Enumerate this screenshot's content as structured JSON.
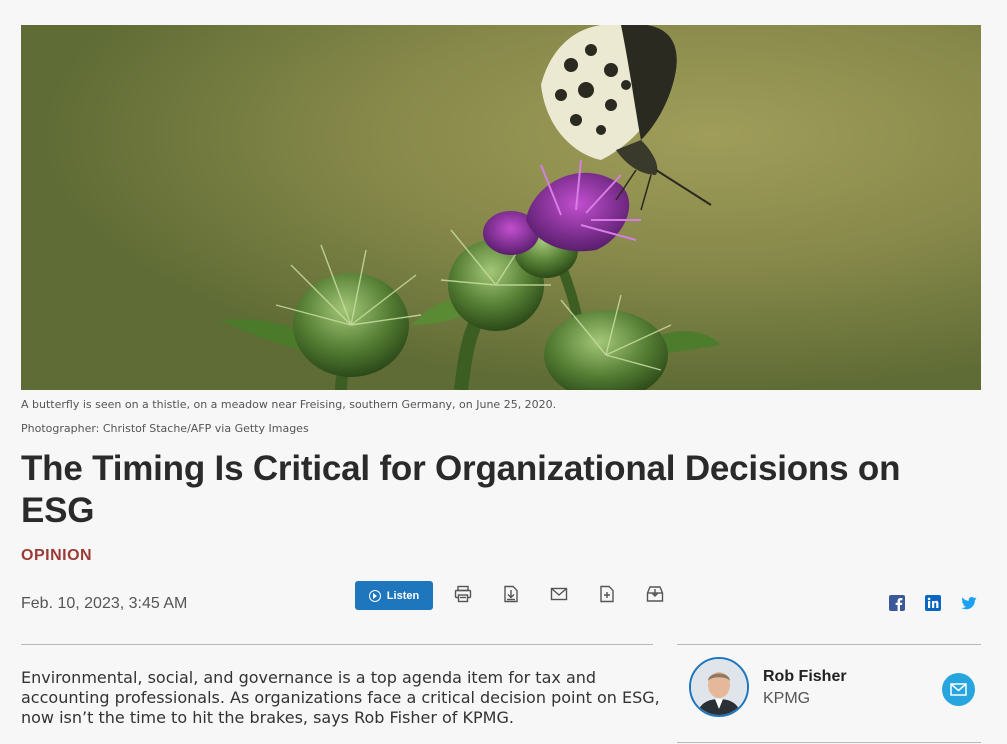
{
  "hero": {
    "caption": "A butterfly is seen on a thistle, on a meadow near Freising, southern Germany, on June 25, 2020.",
    "credit": "Photographer: Christof Stache/AFP via Getty Images"
  },
  "article": {
    "headline": "The Timing Is Critical for Organizational Decisions on ESG",
    "category": "OPINION",
    "date": "Feb. 10, 2023, 3:45 AM",
    "summary": "Environmental, social, and governance is a top agenda item for tax and accounting professionals. As organizations face a critical decision point on ESG, now isn’t the time to hit the brakes, says Rob Fisher of KPMG."
  },
  "toolbar": {
    "listen_label": "Listen",
    "tools": [
      "print-icon",
      "download-pdf-icon",
      "email-icon",
      "add-to-folder-icon",
      "save-icon"
    ]
  },
  "share": {
    "icons": [
      "facebook-icon",
      "linkedin-icon",
      "twitter-icon"
    ]
  },
  "author": {
    "name": "Rob Fisher",
    "organization": "KPMG"
  },
  "colors": {
    "accent_blue": "#1e76bd",
    "opinion_red": "#9c3a35",
    "email_button": "#26a5de"
  }
}
